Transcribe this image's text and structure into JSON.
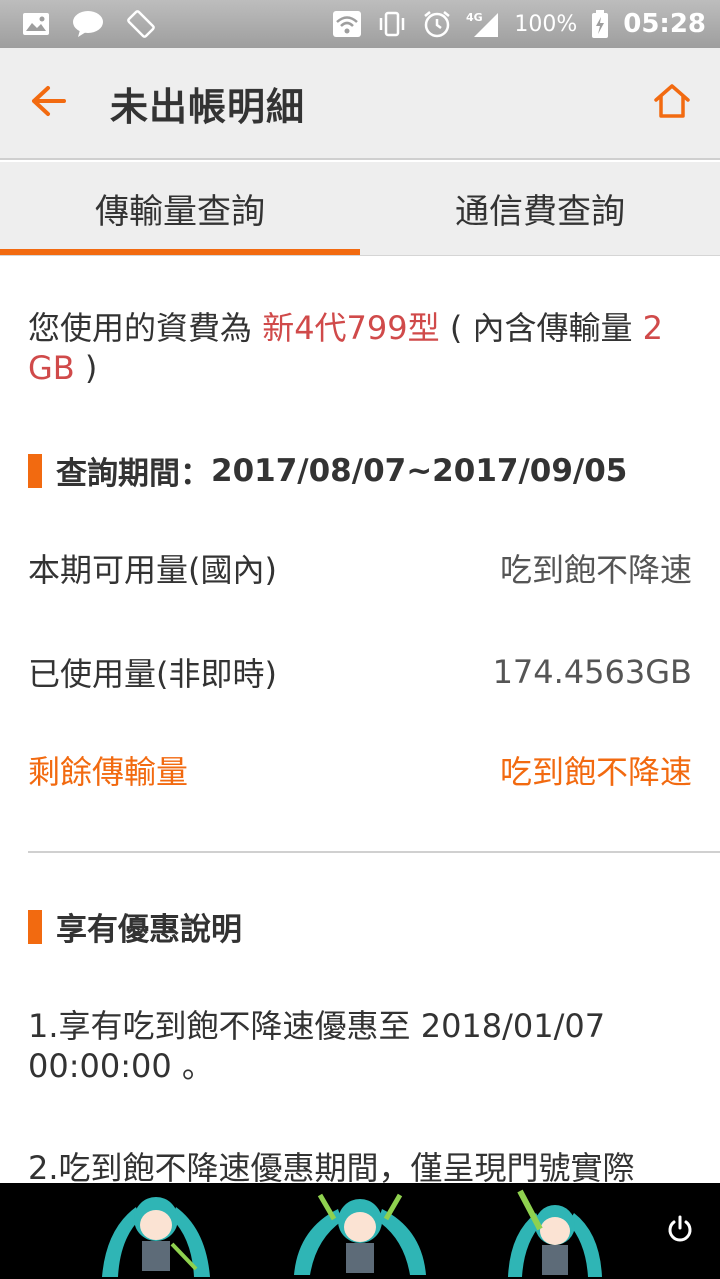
{
  "status_bar": {
    "battery_percent": "100%",
    "time": "05:28",
    "network": "4G",
    "line_app_label": "LINE"
  },
  "app_bar": {
    "title": "未出帳明細"
  },
  "tabs": [
    {
      "label": "傳輸量查詢",
      "active": true
    },
    {
      "label": "通信費查詢",
      "active": false
    }
  ],
  "plan": {
    "prefix": "您使用的資費為 ",
    "plan_name": "新4代799型",
    "middle": " ( 內含傳輸量 ",
    "quota": "2 GB",
    "suffix": " )"
  },
  "query_period": {
    "label": "查詢期間：",
    "range": "2017/08/07~2017/09/05"
  },
  "usage_rows": [
    {
      "label": "本期可用量(國內)",
      "value": "吃到飽不降速"
    },
    {
      "label": "已使用量(非即時)",
      "value": "174.4563GB"
    },
    {
      "label": "剩餘傳輸量",
      "value": "吃到飽不降速"
    }
  ],
  "offers": {
    "heading": "享有優惠說明",
    "items": [
      "1.享有吃到飽不降速優惠至 2018/01/07 00:00:00 。",
      "2.吃到飽不降速優惠期間，僅呈現門號實際"
    ]
  },
  "colors": {
    "accent": "#f26a10",
    "plan_red": "#d04a4a",
    "app_bar_bg": "#eeeeee",
    "status_bar_bg": "#9e9e9e"
  }
}
